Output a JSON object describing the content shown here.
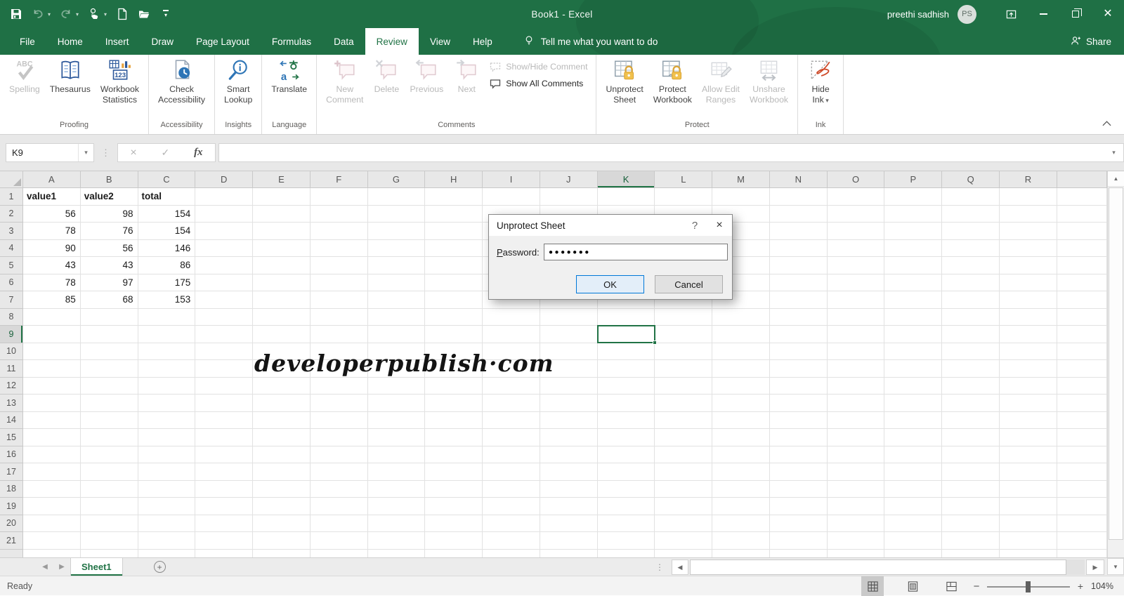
{
  "colors": {
    "accent_green": "#217346",
    "ok_border": "#0078d7",
    "lock_gold": "#f1c14d",
    "selection_border": "#217346"
  },
  "title_bar": {
    "title": "Book1 - Excel",
    "user": "preethi sadhish",
    "initials": "PS"
  },
  "tabs": {
    "items": [
      {
        "label": "File",
        "active": false
      },
      {
        "label": "Home",
        "active": false
      },
      {
        "label": "Insert",
        "active": false
      },
      {
        "label": "Draw",
        "active": false
      },
      {
        "label": "Page Layout",
        "active": false
      },
      {
        "label": "Formulas",
        "active": false
      },
      {
        "label": "Data",
        "active": false
      },
      {
        "label": "Review",
        "active": true
      },
      {
        "label": "View",
        "active": false
      },
      {
        "label": "Help",
        "active": false
      }
    ],
    "tell_me": "Tell me what you want to do",
    "share": "Share"
  },
  "ribbon": {
    "groups": [
      {
        "label": "Proofing",
        "buttons": [
          {
            "name": "spelling",
            "icon": "spelling-icon",
            "lines": [
              "Spelling"
            ],
            "disabled": true
          },
          {
            "name": "thesaurus",
            "icon": "thesaurus-icon",
            "lines": [
              "Thesaurus"
            ],
            "disabled": false
          },
          {
            "name": "workbook-statistics",
            "icon": "workbook-statistics-icon",
            "lines": [
              "Workbook",
              "Statistics"
            ],
            "disabled": false
          }
        ]
      },
      {
        "label": "Accessibility",
        "buttons": [
          {
            "name": "check-accessibility",
            "icon": "check-accessibility-icon",
            "lines": [
              "Check",
              "Accessibility"
            ],
            "disabled": false
          }
        ]
      },
      {
        "label": "Insights",
        "buttons": [
          {
            "name": "smart-lookup",
            "icon": "smart-lookup-icon",
            "lines": [
              "Smart",
              "Lookup"
            ],
            "disabled": false
          }
        ]
      },
      {
        "label": "Language",
        "buttons": [
          {
            "name": "translate",
            "icon": "translate-icon",
            "lines": [
              "Translate"
            ],
            "disabled": false
          }
        ]
      },
      {
        "label": "Comments",
        "buttons": [
          {
            "name": "new-comment",
            "icon": "new-comment-icon",
            "lines": [
              "New",
              "Comment"
            ],
            "disabled": true
          },
          {
            "name": "delete-comment",
            "icon": "delete-comment-icon",
            "lines": [
              "Delete"
            ],
            "disabled": true
          },
          {
            "name": "previous-comment",
            "icon": "previous-comment-icon",
            "lines": [
              "Previous"
            ],
            "disabled": true
          },
          {
            "name": "next-comment",
            "icon": "next-comment-icon",
            "lines": [
              "Next"
            ],
            "disabled": true
          }
        ],
        "smalls": [
          {
            "name": "show-hide-comment",
            "icon": "show-hide-comment-icon",
            "label": "Show/Hide Comment",
            "disabled": true
          },
          {
            "name": "show-all-comments",
            "icon": "show-all-comments-icon",
            "label": "Show All Comments",
            "disabled": false
          }
        ]
      },
      {
        "label": "Protect",
        "buttons": [
          {
            "name": "unprotect-sheet",
            "icon": "unprotect-sheet-icon",
            "lines": [
              "Unprotect",
              "Sheet"
            ],
            "disabled": false
          },
          {
            "name": "protect-workbook",
            "icon": "protect-workbook-icon",
            "lines": [
              "Protect",
              "Workbook"
            ],
            "disabled": false
          },
          {
            "name": "allow-edit-ranges",
            "icon": "allow-edit-ranges-icon",
            "lines": [
              "Allow Edit",
              "Ranges"
            ],
            "disabled": true
          },
          {
            "name": "unshare-workbook",
            "icon": "unshare-workbook-icon",
            "lines": [
              "Unshare",
              "Workbook"
            ],
            "disabled": true
          }
        ]
      },
      {
        "label": "Ink",
        "buttons": [
          {
            "name": "hide-ink",
            "icon": "hide-ink-icon",
            "lines": [
              "Hide",
              "Ink"
            ],
            "disabled": false,
            "dropdown": true
          }
        ]
      }
    ]
  },
  "formula_bar": {
    "name_box": "K9",
    "formula": ""
  },
  "grid": {
    "columns": [
      "A",
      "B",
      "C",
      "D",
      "E",
      "F",
      "G",
      "H",
      "I",
      "J",
      "K",
      "L",
      "M",
      "N",
      "O",
      "P",
      "Q",
      "R"
    ],
    "row_count": 21,
    "selected_column": "K",
    "selected_row": 9,
    "active_cell": "K9",
    "data_rows": [
      [
        "value1",
        "value2",
        "total"
      ],
      [
        "56",
        "98",
        "154"
      ],
      [
        "78",
        "76",
        "154"
      ],
      [
        "90",
        "56",
        "146"
      ],
      [
        "43",
        "43",
        "86"
      ],
      [
        "78",
        "97",
        "175"
      ],
      [
        "85",
        "68",
        "153"
      ]
    ],
    "watermark": "developerpublish·com"
  },
  "dialog": {
    "title": "Unprotect Sheet",
    "help_glyph": "?",
    "close_glyph": "×",
    "password_label_accel": "P",
    "password_label_rest": "assword:",
    "password_value": "●●●●●●●",
    "ok_label": "OK",
    "cancel_label": "Cancel"
  },
  "sheet_bar": {
    "tabs": [
      {
        "label": "Sheet1",
        "active": true
      }
    ]
  },
  "status_bar": {
    "status": "Ready",
    "zoom_level": "104%"
  },
  "glyphs": {
    "caret_down": "▾",
    "dots_v": "⋮",
    "cancel": "×",
    "check": "✓",
    "fx": "fx",
    "arrow_up": "▲",
    "arrow_down": "▼",
    "arrow_left": "◀",
    "arrow_right": "▶",
    "minus": "−",
    "plus": "+",
    "new_sheet": "+"
  }
}
